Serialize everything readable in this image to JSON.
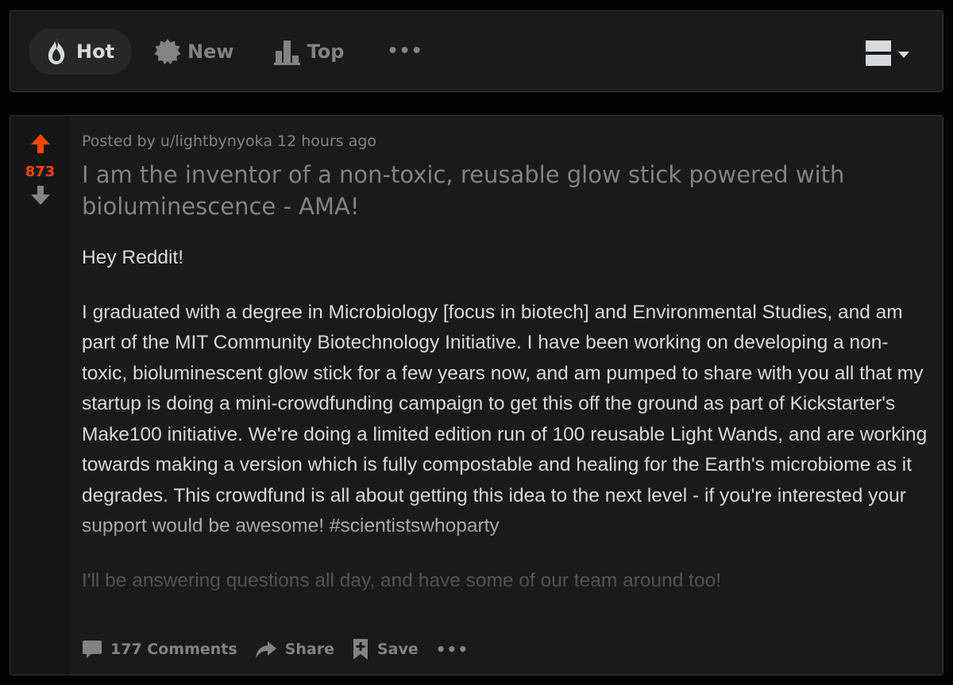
{
  "sort": {
    "items": [
      {
        "label": "Hot",
        "icon": "flame-icon"
      },
      {
        "label": "New",
        "icon": "badge-icon"
      },
      {
        "label": "Top",
        "icon": "bar-chart-icon"
      }
    ],
    "active": "Hot",
    "more": "•••",
    "view_toggle_icon": "card-view-icon"
  },
  "post": {
    "votes": "873",
    "meta": {
      "posted_by": "Posted by",
      "user": "u/lightbynyoka",
      "time": "12 hours ago"
    },
    "title": "I am the inventor of a non-toxic, reusable glow stick powered with bioluminescence - AMA!",
    "body": [
      "Hey Reddit!",
      "I graduated with a degree in Microbiology [focus in biotech] and Environmental Studies, and am part of the MIT Community Biotechnology Initiative. I have been working on developing a non-toxic, bioluminescent glow stick for a few years now, and am pumped to share with you all that my startup is doing a mini-crowdfunding campaign to get this off the ground as part of Kickstarter's Make100 initiative. We're doing a limited edition run of 100 reusable Light Wands, and are working towards making a version which is fully compostable and healing for the Earth's microbiome as it degrades. This crowdfund is all about getting this idea to the next level - if you're interested your support would be awesome! #scientistswhoparty",
      "I'll be answering questions all day, and have some of our team around too!"
    ],
    "actions": {
      "comments": "177 Comments",
      "share": "Share",
      "save": "Save",
      "more": "•••"
    }
  },
  "colors": {
    "background": "#030303",
    "card": "#1a1a1b",
    "border": "#343536",
    "accent_upvote": "#ff4500",
    "text_primary": "#d7dadc",
    "text_muted": "#818384"
  }
}
